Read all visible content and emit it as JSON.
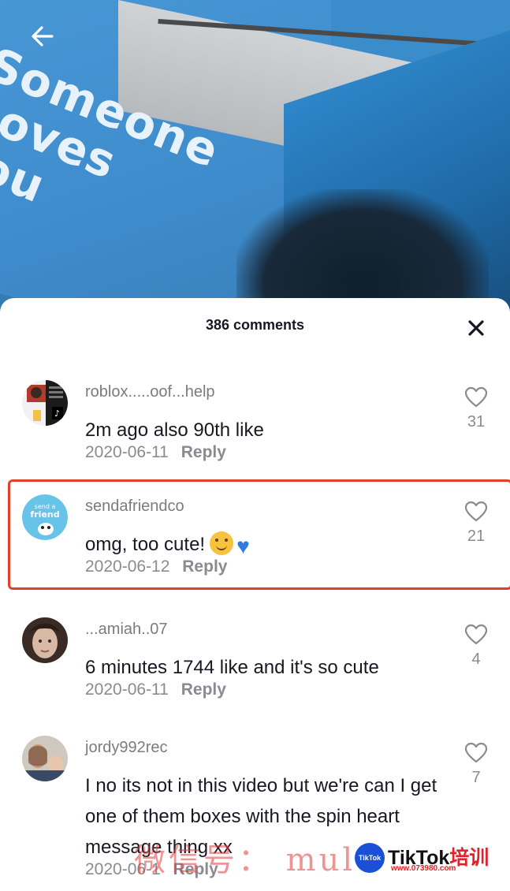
{
  "video": {
    "caption": "Someone\nLoves\nYou"
  },
  "sheet": {
    "title": "386 comments"
  },
  "comments": [
    {
      "username": "roblox.....oof...help",
      "text": "2m ago also 90th like",
      "date": "2020-06-11",
      "reply_label": "Reply",
      "likes": "31",
      "highlighted": false
    },
    {
      "username": "sendafriendco",
      "text": "omg, too cute!",
      "date": "2020-06-12",
      "reply_label": "Reply",
      "likes": "21",
      "highlighted": true,
      "emoji": [
        "hugging-face",
        "blue-heart"
      ]
    },
    {
      "username": "...amiah..07",
      "text": "6 minutes 1744 like and it's so cute",
      "date": "2020-06-11",
      "reply_label": "Reply",
      "likes": "4",
      "highlighted": false
    },
    {
      "username": "jordy992rec",
      "text": "I no its not in this video but we're can I get one of them boxes with the spin heart message thing xx",
      "date": "2020-06-1",
      "reply_label": "Reply",
      "likes": "7",
      "highlighted": false
    }
  ],
  "avatars": {
    "sendafriend_line1": "send a",
    "sendafriend_line2": "friend"
  },
  "watermark": {
    "text": "微信号： mulu",
    "badge_circle": "TikTok",
    "badge_brand": "TikTok",
    "badge_cn": "培训",
    "badge_url": "www.073980.com"
  },
  "colors": {
    "highlight_border": "#e0412b",
    "primary_text": "#161823",
    "secondary_text": "#8a8b91"
  },
  "icons": [
    "back-arrow-icon",
    "close-icon",
    "heart-outline-icon"
  ]
}
